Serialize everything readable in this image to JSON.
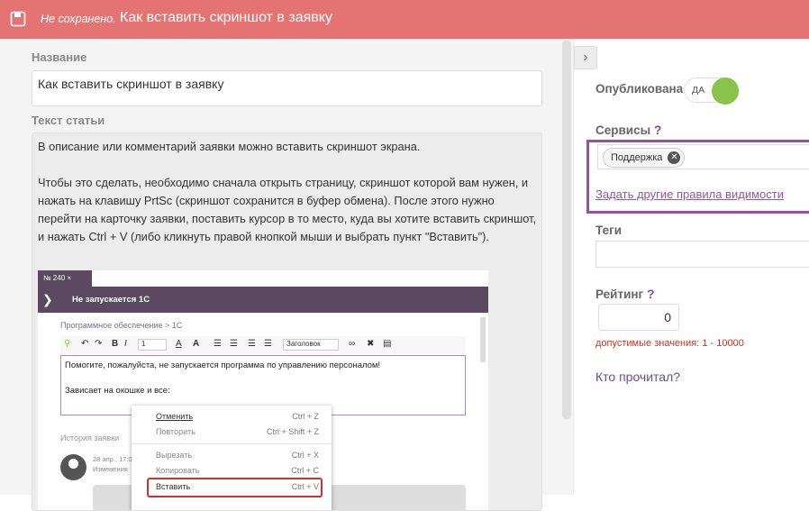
{
  "topbar": {
    "unsaved_label": "Не сохранено.",
    "title": "Как вставить скриншот в заявку",
    "color": "#e57373"
  },
  "form": {
    "name_label": "Название",
    "name_value": "Как вставить скриншот в заявку",
    "text_label": "Текст статьи",
    "paragraphs": [
      "В описание или комментарий заявки можно вставить скриншот экрана.",
      "Чтобы это сделать, необходимо сначала открыть страницу, скриншот которой вам нужен, и нажать на клавишу PrtSc (скриншот сохранится в буфер обмена). После этого нужно перейти на карточку заявки, поставить курсор в то место, куда вы хотите вставить скриншот, и нажать Ctrl + V (либо кликнуть правой кнопкой мыши и выбрать пункт \"Вставить\")."
    ]
  },
  "screenshot": {
    "tab": "№ 240 ×",
    "header_title": "Не запускается 1С",
    "breadcrumb": "Программное обеспечение > 1С",
    "toolbar": {
      "font_size": "1",
      "heading": "Заголовок"
    },
    "editor_lines": [
      "Помогите, пожалуйста, не запускается программа по управлению персоналом!",
      "",
      "Зависает на окошке и все:"
    ],
    "history_label": "История заявки",
    "date": "28 апр., 17:0",
    "change": "Изменения",
    "context_menu": [
      {
        "label": "Отменить",
        "shortcut": "Ctrl + Z"
      },
      {
        "label": "Повторить",
        "shortcut": "Ctrl + Shift + Z"
      },
      {
        "label": "Вырезать",
        "shortcut": "Ctrl + X"
      },
      {
        "label": "Копировать",
        "shortcut": "Ctrl + C"
      },
      {
        "label": "Вставить",
        "shortcut": "Ctrl + V"
      }
    ]
  },
  "side": {
    "published_label": "Опубликована",
    "published_value": "ДА",
    "services_label": "Сервисы",
    "service_chip": "Поддержка",
    "visibility_link": "Задать другие правила видимости",
    "tags_label": "Теги",
    "rating_label": "Рейтинг",
    "rating_value": "0",
    "rating_hint": "допустимые значения: 1 - 10000",
    "who_read": "Кто прочитал?",
    "help_mark": "?",
    "accent_color": "#9c4fa8",
    "toggle_color": "#8bc34a"
  }
}
